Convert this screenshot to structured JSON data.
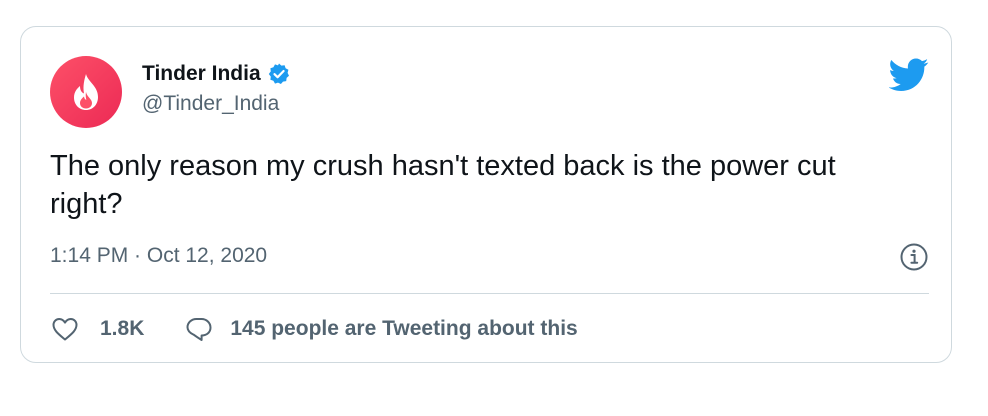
{
  "author": {
    "display_name": "Tinder India",
    "handle": "@Tinder_India",
    "verified": true,
    "avatar_icon": "tinder-flame-icon",
    "avatar_color": "#fd5068"
  },
  "tweet": {
    "text": "The only reason my crush hasn't texted back is the power cut right?",
    "timestamp": "1:14 PM · Oct 12, 2020"
  },
  "actions": {
    "like_count": "1.8K",
    "reply_text": "145 people are Tweeting about this"
  },
  "icons": {
    "brand": "twitter-bird-icon",
    "info": "info-icon",
    "like": "heart-icon",
    "reply": "speech-bubble-icon",
    "verified": "verified-badge-icon"
  },
  "colors": {
    "twitter_blue": "#1d9bf0",
    "text_primary": "#0f1419",
    "text_secondary": "#536471",
    "border": "#cfd9de"
  }
}
